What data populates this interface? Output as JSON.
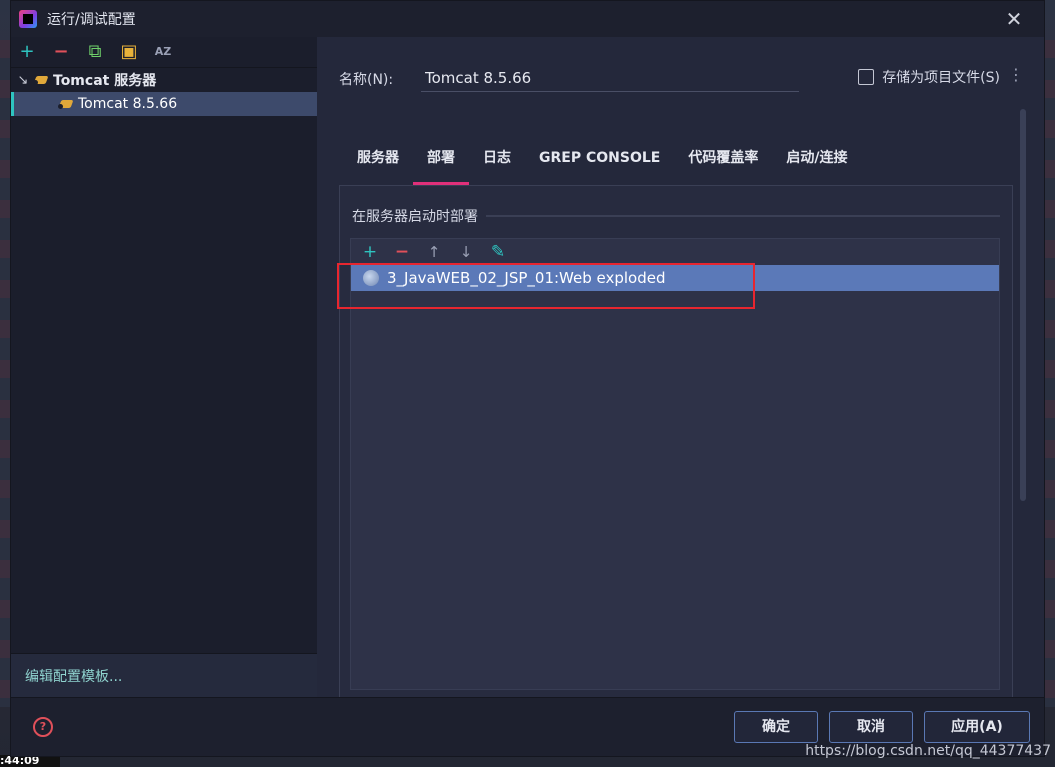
{
  "window": {
    "title": "运行/调试配置",
    "close_glyph": "✕"
  },
  "left_toolbar": {
    "add": "+",
    "remove": "−",
    "copy": "⧉",
    "folder": "▣",
    "sort": "AZ"
  },
  "tree": {
    "root_label": "Tomcat 服务器",
    "root_arrow": "↘",
    "child_label": "Tomcat 8.5.66"
  },
  "left_footer": {
    "edit_templates": "编辑配置模板..."
  },
  "config": {
    "name_label": "名称(N):",
    "name_value": "Tomcat 8.5.66",
    "store_label": "存储为项目文件(S)",
    "kebab": "⋮"
  },
  "tabs": [
    {
      "label": "服务器",
      "active": false
    },
    {
      "label": "部署",
      "active": true
    },
    {
      "label": "日志",
      "active": false
    },
    {
      "label": "GREP CONSOLE",
      "active": false
    },
    {
      "label": "代码覆盖率",
      "active": false
    },
    {
      "label": "启动/连接",
      "active": false
    }
  ],
  "deploy": {
    "section_title": "在服务器启动时部署",
    "toolbar": {
      "add": "+",
      "remove": "−",
      "up": "↑",
      "down": "↓",
      "edit": "✎"
    },
    "artifacts": [
      "3_JavaWEB_02_JSP_01:Web exploded"
    ]
  },
  "buttons": {
    "help": "?",
    "ok": "确定",
    "cancel": "取消",
    "apply": "应用(A)"
  },
  "watermark": "https://blog.csdn.net/qq_44377437",
  "taskbar": {
    "clock": ":44:09"
  },
  "colors": {
    "accent_tab": "#e0307a",
    "selection": "#5b79b8",
    "highlight_box": "#e8262f",
    "teal": "#2ec4c0"
  }
}
